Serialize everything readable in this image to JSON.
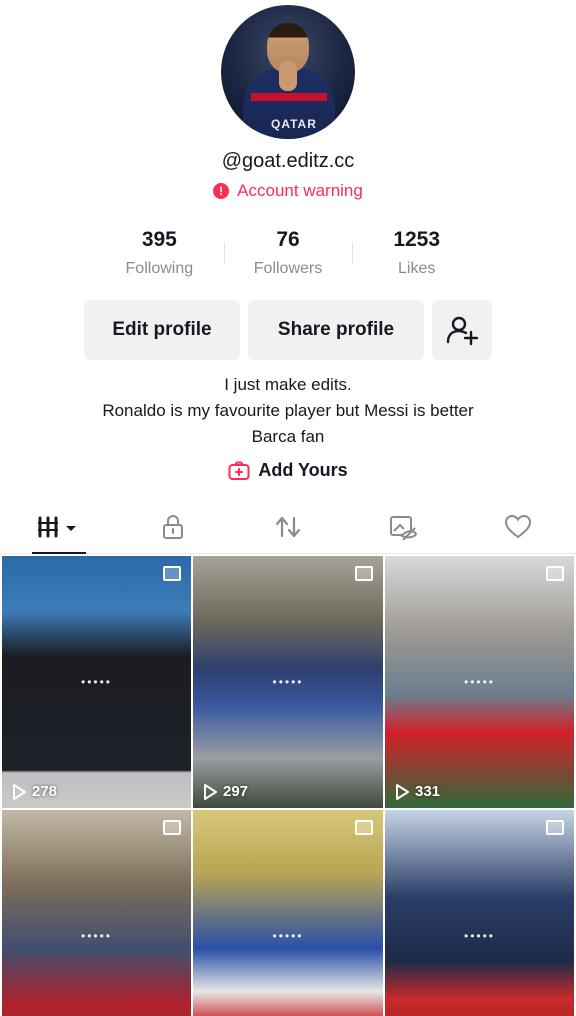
{
  "profile": {
    "username": "@goat.editz.cc",
    "warning": "Account warning",
    "avatar_logo": "QATAR"
  },
  "stats": [
    {
      "value": "395",
      "label": "Following"
    },
    {
      "value": "76",
      "label": "Followers"
    },
    {
      "value": "1253",
      "label": "Likes"
    }
  ],
  "buttons": {
    "edit": "Edit profile",
    "share": "Share profile",
    "add_friend_icon": "person-add-icon"
  },
  "bio": {
    "line1": "I just make edits.",
    "line2": "Ronaldo is my favourite player but Messi is better",
    "line3": "Barca fan"
  },
  "add_yours": "Add Yours",
  "tabs": [
    "videos-grid-icon",
    "lock-icon",
    "repost-icon",
    "tagged-icon",
    "heart-icon"
  ],
  "grid": [
    {
      "views": "278",
      "dots": "•••••"
    },
    {
      "views": "297",
      "dots": "•••••"
    },
    {
      "views": "331",
      "dots": "•••••"
    },
    {
      "views": "",
      "dots": "•••••"
    },
    {
      "views": "",
      "dots": "•••••"
    },
    {
      "views": "",
      "dots": "•••••"
    }
  ],
  "colors": {
    "accent": "#fe2c55",
    "text": "#161823",
    "muted": "#8a8b91",
    "button_bg": "#f1f1f2"
  }
}
